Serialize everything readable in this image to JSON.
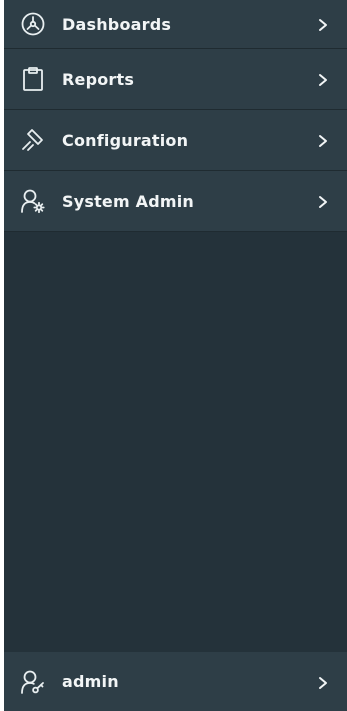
{
  "sidebar": {
    "items": [
      {
        "label": "Dashboards",
        "icon": "dashboard-gauge-icon"
      },
      {
        "label": "Reports",
        "icon": "clipboard-icon"
      },
      {
        "label": "Configuration",
        "icon": "hammer-icon"
      },
      {
        "label": "System Admin",
        "icon": "user-gear-icon"
      }
    ],
    "user": {
      "label": "admin",
      "icon": "user-key-icon"
    }
  },
  "colors": {
    "sidebar_bg": "#24323a",
    "item_bg": "#2e3e47",
    "text": "#f2f5f6"
  }
}
